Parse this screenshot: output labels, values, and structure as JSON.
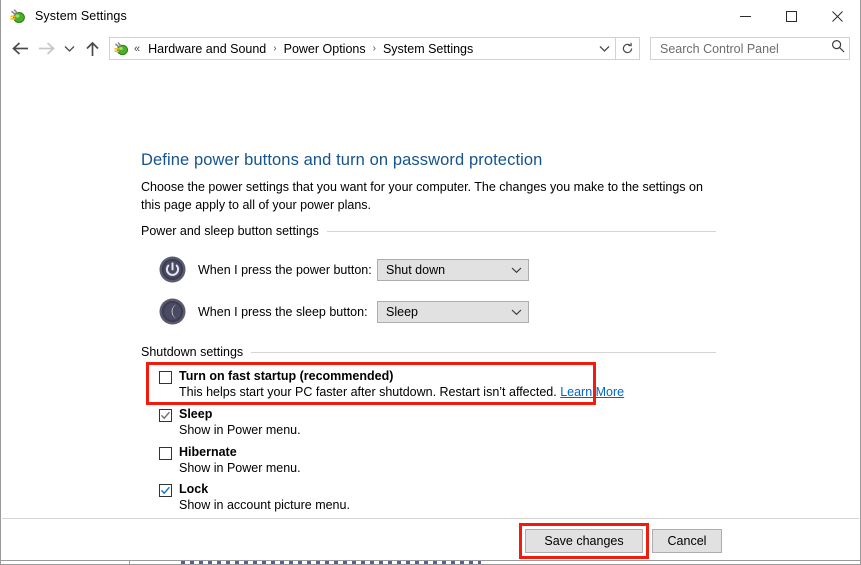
{
  "window": {
    "title": "System Settings",
    "app_icon": "power-plug-icon",
    "controls": {
      "minimize": "minimize-icon",
      "maximize": "maximize-icon",
      "close": "close-icon"
    }
  },
  "nav": {
    "back": "back-arrow-icon",
    "forward": "forward-arrow-icon",
    "history": "chevron-down-icon",
    "up": "up-arrow-icon",
    "address_icon": "power-plug-icon",
    "overflow": "«",
    "breadcrumbs": [
      {
        "label": "Hardware and Sound"
      },
      {
        "label": "Power Options"
      },
      {
        "label": "System Settings"
      }
    ],
    "separator": "›",
    "dropdown": "chevron-down-icon",
    "refresh": "refresh-icon"
  },
  "search": {
    "placeholder": "Search Control Panel",
    "value": "",
    "icon": "search-icon"
  },
  "main": {
    "title": "Define power buttons and turn on password protection",
    "description": "Choose the power settings that you want for your computer. The changes you make to the settings on this page apply to all of your power plans.",
    "groups": [
      {
        "id": "power-sleep",
        "label": "Power and sleep button settings",
        "rows": [
          {
            "icon": "power-button-icon",
            "label": "When I press the power button:",
            "value": "Shut down"
          },
          {
            "icon": "sleep-moon-icon",
            "label": "When I press the sleep button:",
            "value": "Sleep"
          }
        ]
      },
      {
        "id": "shutdown",
        "label": "Shutdown settings",
        "items": [
          {
            "id": "fast-startup",
            "title": "Turn on fast startup (recommended)",
            "checked": false,
            "check_style": "none",
            "sub": "This helps start your PC faster after shutdown. Restart isn’t affected.",
            "link": "Learn More",
            "highlighted": true
          },
          {
            "id": "sleep",
            "title": "Sleep",
            "checked": true,
            "check_style": "gray",
            "sub": "Show in Power menu.",
            "link": "",
            "highlighted": false
          },
          {
            "id": "hibernate",
            "title": "Hibernate",
            "checked": false,
            "check_style": "none",
            "sub": "Show in Power menu.",
            "link": "",
            "highlighted": false
          },
          {
            "id": "lock",
            "title": "Lock",
            "checked": true,
            "check_style": "blue",
            "sub": "Show in account picture menu.",
            "link": "",
            "highlighted": false
          }
        ]
      }
    ]
  },
  "footer": {
    "save_label": "Save changes",
    "cancel_label": "Cancel",
    "save_highlighted": true
  },
  "colors": {
    "heading": "#16538f",
    "link": "#0066cc",
    "annotation": "#f01c0e",
    "checkbox_check": "#0078d7",
    "button_face": "#e1e1e1"
  }
}
